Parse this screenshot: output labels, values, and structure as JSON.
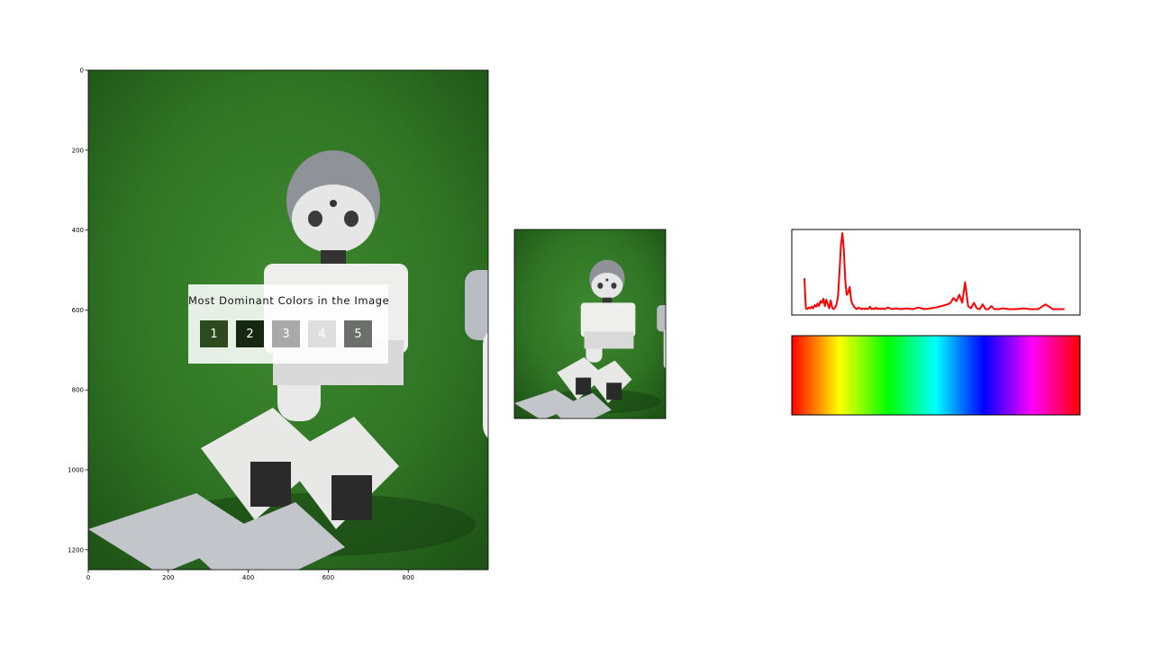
{
  "chart_data": [
    {
      "type": "image",
      "x_ticks": [
        0,
        200,
        400,
        600,
        800
      ],
      "y_ticks": [
        0,
        200,
        400,
        600,
        800,
        1000,
        1200
      ],
      "xlim": [
        0,
        1000
      ],
      "ylim": [
        0,
        1250
      ],
      "overlay": {
        "title": "Most Dominant Colors in the Image",
        "swatches": [
          {
            "label": "1",
            "color": "#2c4a1e"
          },
          {
            "label": "2",
            "color": "#16280f"
          },
          {
            "label": "3",
            "color": "#a9a9a9"
          },
          {
            "label": "4",
            "color": "#dedede"
          },
          {
            "label": "5",
            "color": "#6c706b"
          }
        ]
      }
    },
    {
      "type": "image"
    },
    {
      "type": "line",
      "color": "#ff0000",
      "xlim": [
        0,
        180
      ],
      "ylim": [
        0,
        1
      ],
      "x": [
        0,
        1,
        2,
        3,
        4,
        5,
        6,
        7,
        8,
        9,
        10,
        11,
        12,
        13,
        14,
        15,
        16,
        17,
        18,
        19,
        20,
        21,
        22,
        23,
        24,
        25,
        26,
        27,
        28,
        29,
        30,
        31,
        32,
        33,
        34,
        35,
        36,
        37,
        38,
        39,
        40,
        41,
        42,
        43,
        44,
        45,
        46,
        47,
        48,
        49,
        50,
        51,
        52,
        53,
        55,
        57,
        60,
        63,
        66,
        70,
        74,
        78,
        82,
        86,
        90,
        94,
        98,
        100,
        102,
        104,
        106,
        108,
        110,
        112,
        114,
        116,
        118,
        120,
        122,
        124,
        126,
        128,
        130,
        133,
        136,
        140,
        145,
        150,
        155,
        160,
        165,
        170,
        175,
        178
      ],
      "y": [
        0.43,
        0.05,
        0.04,
        0.06,
        0.05,
        0.07,
        0.05,
        0.09,
        0.07,
        0.11,
        0.08,
        0.14,
        0.12,
        0.17,
        0.08,
        0.16,
        0.1,
        0.05,
        0.15,
        0.06,
        0.04,
        0.06,
        0.1,
        0.2,
        0.5,
        0.85,
        1.0,
        0.78,
        0.4,
        0.22,
        0.25,
        0.32,
        0.15,
        0.1,
        0.07,
        0.05,
        0.04,
        0.06,
        0.05,
        0.04,
        0.05,
        0.04,
        0.05,
        0.04,
        0.05,
        0.07,
        0.04,
        0.05,
        0.04,
        0.06,
        0.04,
        0.05,
        0.04,
        0.05,
        0.04,
        0.06,
        0.04,
        0.05,
        0.04,
        0.05,
        0.04,
        0.06,
        0.04,
        0.05,
        0.06,
        0.08,
        0.1,
        0.12,
        0.18,
        0.14,
        0.22,
        0.12,
        0.38,
        0.08,
        0.05,
        0.12,
        0.05,
        0.04,
        0.1,
        0.04,
        0.04,
        0.08,
        0.04,
        0.04,
        0.05,
        0.04,
        0.04,
        0.05,
        0.04,
        0.04,
        0.1,
        0.04,
        0.04,
        0.04
      ]
    },
    {
      "type": "heatmap",
      "gradient": [
        "#ff0000",
        "#ffff00",
        "#00ff00",
        "#00ffff",
        "#0000ff",
        "#ff00ff",
        "#ff0000"
      ]
    }
  ]
}
